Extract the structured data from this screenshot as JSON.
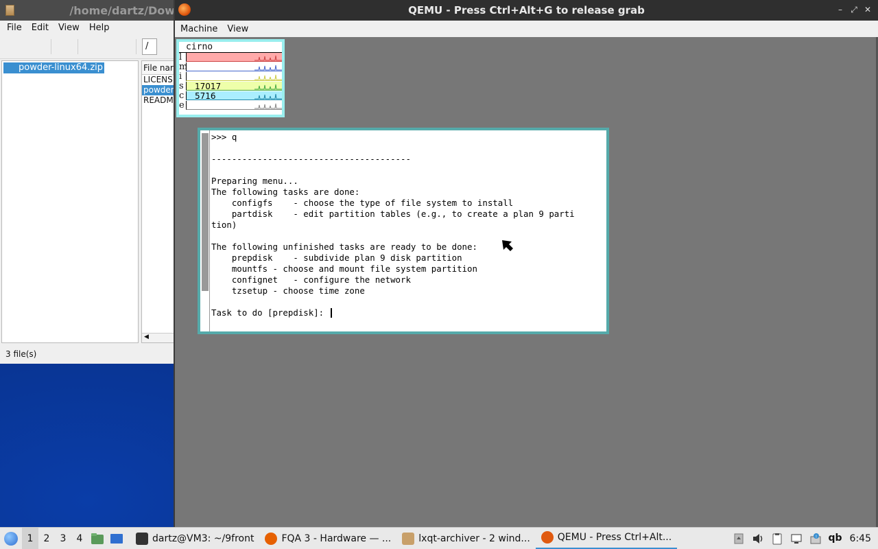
{
  "archiver": {
    "title": "/home/dartz/Dow",
    "menu": [
      "File",
      "Edit",
      "View",
      "Help"
    ],
    "path": "/",
    "tree_selected": "powder-linux64.zip",
    "list_header": "File nar",
    "files": [
      "LICENS",
      "powder",
      "READM"
    ],
    "selected_index": 1,
    "status": "3 file(s)"
  },
  "qemu": {
    "title": "QEMU - Press Ctrl+Alt+G to release grab",
    "menu": [
      "Machine",
      "View"
    ],
    "window_controls": [
      "–",
      "⤢",
      "✕"
    ]
  },
  "stats": {
    "host": "cirno",
    "rows": [
      {
        "label": "l",
        "value": "",
        "color": "#ffaaaa",
        "line": "#cc4444"
      },
      {
        "label": "m",
        "value": "",
        "color": "#ffffff",
        "line": "#4466cc"
      },
      {
        "label": "i",
        "value": "",
        "color": "#ffffff",
        "line": "#cccc44"
      },
      {
        "label": "s",
        "value": "17017",
        "color": "#eeffaa",
        "line": "#44aa44"
      },
      {
        "label": "c",
        "value": "5716",
        "color": "#aaeeff",
        "line": "#2288aa"
      },
      {
        "label": "e",
        "value": "",
        "color": "#ffffff",
        "line": "#888888"
      }
    ]
  },
  "terminal": {
    "lines": [
      ">>> q",
      "",
      "---------------------------------------",
      "",
      "Preparing menu...",
      "The following tasks are done:",
      "    configfs    - choose the type of file system to install",
      "    partdisk    - edit partition tables (e.g., to create a plan 9 parti",
      "tion)",
      "",
      "The following unfinished tasks are ready to be done:",
      "    prepdisk    - subdivide plan 9 disk partition",
      "    mountfs - choose and mount file system partition",
      "    confignet   - configure the network",
      "    tzsetup - choose time zone",
      ""
    ],
    "prompt": "Task to do [prepdisk]: "
  },
  "taskbar": {
    "desktops": [
      "1",
      "2",
      "3",
      "4"
    ],
    "active_desktop": 0,
    "tasks": [
      {
        "label": "dartz@VM3: ~/9front",
        "icon": "terminal-icon",
        "color": "#333333"
      },
      {
        "label": "FQA 3 - Hardware — ...",
        "icon": "firefox-icon",
        "color": "#e66000"
      },
      {
        "label": "lxqt-archiver - 2 wind...",
        "icon": "archive-icon",
        "color": "#c8a06a"
      },
      {
        "label": "QEMU - Press Ctrl+Alt...",
        "icon": "qemu-icon",
        "color": "#e05a10"
      }
    ],
    "active_task": 3,
    "user_label": "qb",
    "clock": "6:45"
  }
}
